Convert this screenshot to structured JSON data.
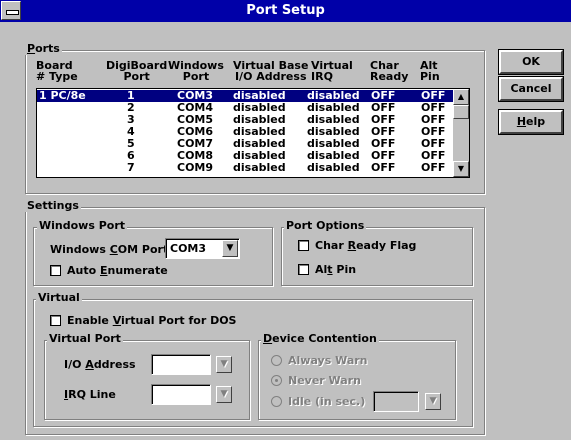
{
  "window": {
    "title": "Port Setup"
  },
  "buttons": {
    "ok": "OK",
    "cancel": "Cancel",
    "help": "Help"
  },
  "ports": {
    "group_label": "Ports",
    "headers": [
      [
        "Board",
        "# Type"
      ],
      [
        "DigiBoard",
        "Port"
      ],
      [
        "Windows",
        "Port"
      ],
      [
        "Virtual Base",
        "I/O Address"
      ],
      [
        "Virtual",
        "IRQ"
      ],
      [
        "Char",
        "Ready"
      ],
      [
        "Alt",
        "Pin"
      ]
    ],
    "rows": [
      [
        "1  PC/8e",
        "1",
        "COM3",
        "disabled",
        "disabled",
        "OFF",
        "OFF"
      ],
      [
        "",
        "2",
        "COM4",
        "disabled",
        "disabled",
        "OFF",
        "OFF"
      ],
      [
        "",
        "3",
        "COM5",
        "disabled",
        "disabled",
        "OFF",
        "OFF"
      ],
      [
        "",
        "4",
        "COM6",
        "disabled",
        "disabled",
        "OFF",
        "OFF"
      ],
      [
        "",
        "5",
        "COM7",
        "disabled",
        "disabled",
        "OFF",
        "OFF"
      ],
      [
        "",
        "6",
        "COM8",
        "disabled",
        "disabled",
        "OFF",
        "OFF"
      ],
      [
        "",
        "7",
        "COM9",
        "disabled",
        "disabled",
        "OFF",
        "OFF"
      ]
    ]
  },
  "settings": {
    "group_label": "Settings",
    "windows_port": {
      "group_label": "Windows Port",
      "com_label": "Windows COM Port",
      "com_value": "COM3",
      "auto_enumerate": "Auto Enumerate",
      "auto_enumerate_checked": false
    },
    "port_options": {
      "group_label": "Port Options",
      "char_ready": "Char Ready Flag",
      "alt_pin": "Alt Pin"
    },
    "virtual": {
      "group_label": "Virtual",
      "enable_label": "Enable Virtual Port for DOS",
      "virtual_port_label": "Virtual Port",
      "io_label": "I/O Address",
      "irq_label": "IRQ Line",
      "contention_label": "Device Contention",
      "always_warn": "Always Warn",
      "never_warn": "Never Warn",
      "idle": "Idle (in sec.)"
    }
  }
}
